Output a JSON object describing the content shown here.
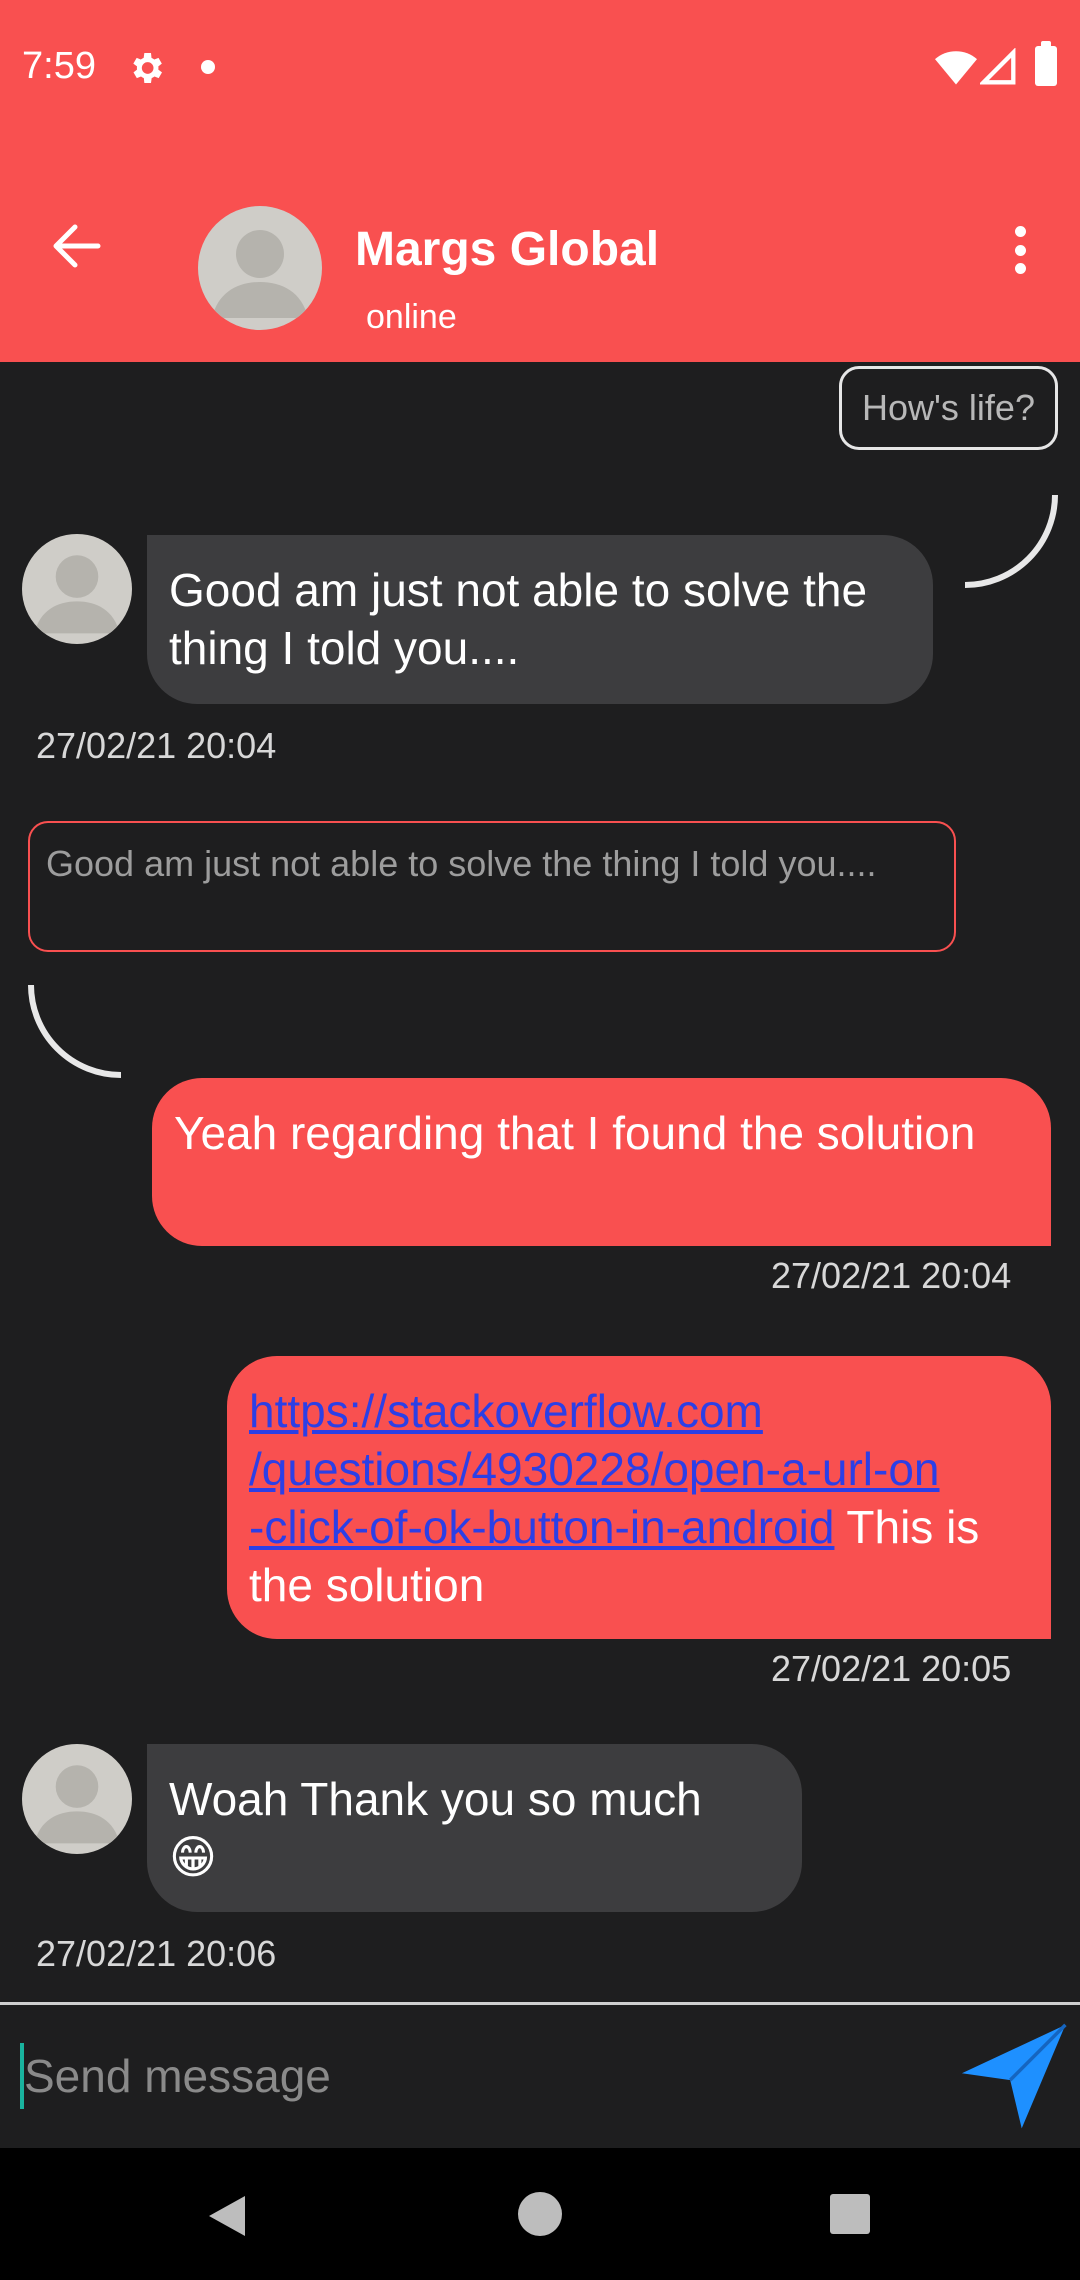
{
  "status_bar": {
    "time": "7:59"
  },
  "header": {
    "contact_name": "Margs Global",
    "contact_status": "online"
  },
  "messages": [
    {
      "quote": "How's life?"
    },
    {
      "direction": "incoming",
      "text": "Good am just not able to solve the thing I told you....",
      "time": "27/02/21  20:04"
    },
    {
      "quoted_text": "Good am just not able to solve the thing I told you...."
    },
    {
      "direction": "outgoing",
      "text": "Yeah regarding that I found the solution",
      "time": "27/02/21  20:04"
    },
    {
      "direction": "outgoing",
      "link": "https://stackoverflow.com/questions/4930228/open-a-url-on-click-of-ok-button-in-android",
      "link_line1": "https://stackoverflow.com",
      "link_line2": "/questions/4930228/open-a-url-on",
      "link_line3": "-click-of-ok-button-in-android",
      "suffix": " This is the solution",
      "time": "27/02/21  20:05"
    },
    {
      "direction": "incoming",
      "text": "Woah Thank you so much",
      "emoji": "😁",
      "time": "27/02/21  20:06"
    }
  ],
  "composer": {
    "placeholder": "Send message"
  },
  "colors": {
    "accent": "#f95050",
    "background": "#1e1e1f",
    "incoming_bubble": "#3d3d3f",
    "link": "#2c3fe6",
    "send_icon": "#1e90ff"
  },
  "icons": {
    "back": "arrow-left-icon",
    "more": "more-vert-icon",
    "send": "send-icon",
    "settings": "gear-icon"
  }
}
